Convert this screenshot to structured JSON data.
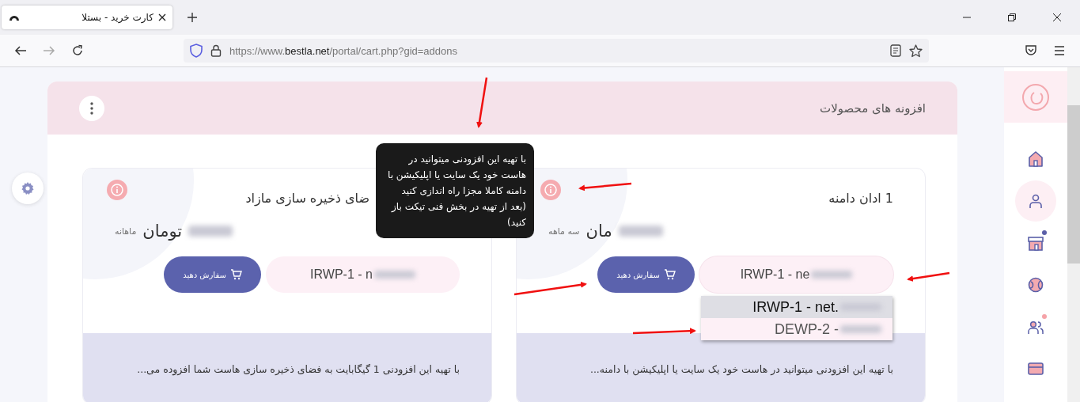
{
  "browser": {
    "tab": {
      "title": "کارت خرید - بستلا"
    },
    "url": {
      "prefix": "https://www.",
      "domain": "bestla.net",
      "path": "/portal/cart.php?gid=addons"
    }
  },
  "page": {
    "title": "افزونه های محصولات"
  },
  "cards": [
    {
      "title": "1 ادان دامنه",
      "price_currency": "مان",
      "period": "سه ماهه",
      "select": {
        "value": "IRWP-1 - ne",
        "open": true,
        "options": [
          {
            "label": "IRWP-1 - net.",
            "selected": true
          },
          {
            "label": "DEWP-2 -",
            "selected": false
          }
        ]
      },
      "order_button": "سفارش دهید",
      "description": "با تهیه این افزودنی میتوانید در هاست خود یک سایت یا اپلیکیشن با دامنه...",
      "tooltip": "با تهیه این افزودنی میتوانید در هاست خود یک سایت یا اپلیکیشن با دامنه کاملا مجزا راه اندازی کنید (بعد از تهیه در بخش فنی تیکت باز کنید)"
    },
    {
      "title": "ضای ذخیره سازی مازاد",
      "price_currency": "تومان",
      "period": "ماهانه",
      "select": {
        "value": "IRWP-1 - n",
        "open": false
      },
      "order_button": "سفارش دهید",
      "description": "با تهیه این افزودنی 1 گیگابایت به فضای ذخیره سازی هاست شما افزوده می..."
    }
  ],
  "sidebar": {
    "items": [
      {
        "kind": "home",
        "selected": false
      },
      {
        "kind": "user",
        "selected": true
      },
      {
        "kind": "store",
        "selected": false,
        "color": "#5b5fa8"
      },
      {
        "kind": "globe",
        "selected": false
      },
      {
        "kind": "users",
        "selected": false,
        "color": "#f5a3a8"
      },
      {
        "kind": "card",
        "selected": false
      }
    ]
  }
}
